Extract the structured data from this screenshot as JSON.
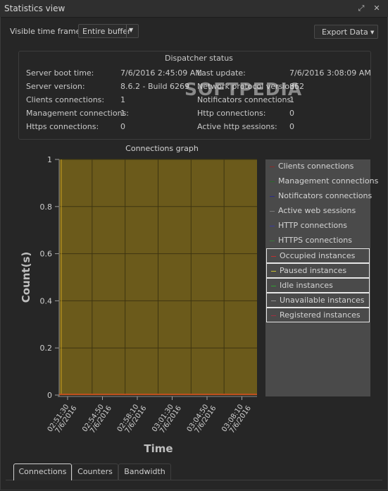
{
  "window": {
    "title": "Statistics view"
  },
  "toolbar": {
    "time_frame_label": "Visible time frame:",
    "time_frame_value": "Entire buffer",
    "export_label": "Export Data"
  },
  "dispatcher": {
    "title": "Dispatcher status",
    "left": [
      {
        "label": "Server boot time:",
        "value": "7/6/2016 2:45:09 AM"
      },
      {
        "label": "Server version:",
        "value": "8.6.2 - Build 6269"
      },
      {
        "label": "Clients connections:",
        "value": "1"
      },
      {
        "label": "Management connections:",
        "value": "1"
      },
      {
        "label": "Https connections:",
        "value": "0"
      }
    ],
    "right": [
      {
        "label": "Last update:",
        "value": "7/6/2016 3:08:09 AM"
      },
      {
        "label": "Network protocol version:",
        "value": "862"
      },
      {
        "label": "Notificators connections:",
        "value": "1"
      },
      {
        "label": "Http connections:",
        "value": "0"
      },
      {
        "label": "Active http sessions:",
        "value": "0"
      }
    ]
  },
  "watermark": "SOFTPEDIA",
  "chart_data": {
    "type": "area",
    "title": "Connections graph",
    "xlabel": "Time",
    "ylabel": "Count(s)",
    "ylim": [
      0,
      1
    ],
    "yticks": [
      "0",
      "0.2",
      "0.4",
      "0.6",
      "0.8",
      "1"
    ],
    "x": [
      [
        "02:51:30",
        "7/6/2016"
      ],
      [
        "02:54:50",
        "7/6/2016"
      ],
      [
        "02:58:10",
        "7/6/2016"
      ],
      [
        "03:01:30",
        "7/6/2016"
      ],
      [
        "03:04:50",
        "7/6/2016"
      ],
      [
        "03:08:10",
        "7/6/2016"
      ]
    ],
    "fill_color": "#6b5a1b",
    "grid": true,
    "legend_position": "right",
    "series": [
      {
        "name": "Clients connections",
        "color": "#8a2a2a",
        "boxed": false
      },
      {
        "name": "Management connections",
        "color": "#2a6a2a",
        "boxed": false
      },
      {
        "name": "Notificators connections",
        "color": "#2a2a8a",
        "boxed": false
      },
      {
        "name": "Active web sessions",
        "color": "#7a7a7a",
        "boxed": false
      },
      {
        "name": "HTTP connections",
        "color": "#3a3aa0",
        "boxed": false
      },
      {
        "name": "HTTPS connections",
        "color": "#3a7a3a",
        "boxed": false
      },
      {
        "name": "Occupied instances",
        "color": "#c03030",
        "boxed": true
      },
      {
        "name": "Paused instances",
        "color": "#c8c030",
        "boxed": true
      },
      {
        "name": "Idle instances",
        "color": "#30a030",
        "boxed": true
      },
      {
        "name": "Unavailable instances",
        "color": "#909090",
        "boxed": true
      },
      {
        "name": "Registered instances",
        "color": "#a03040",
        "boxed": true
      }
    ]
  },
  "tabs": [
    {
      "label": "Connections",
      "active": true
    },
    {
      "label": "Counters",
      "active": false
    },
    {
      "label": "Bandwidth",
      "active": false
    }
  ]
}
